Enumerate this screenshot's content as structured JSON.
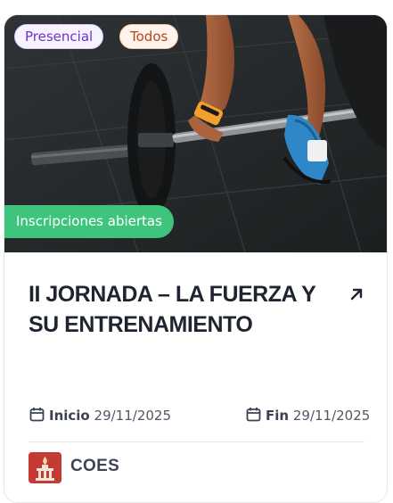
{
  "event_card": {
    "tags": {
      "modality": "Presencial",
      "audience": "Todos"
    },
    "status": "Inscripciones abiertas",
    "title": "II JORNADA – LA FUERZA Y SU ENTRENAMIENTO",
    "dates": {
      "start_label": "Inicio",
      "start_value": "29/11/2025",
      "end_label": "Fin",
      "end_value": "29/11/2025"
    },
    "organizer": {
      "name": "COES"
    },
    "icons": {
      "open": "arrow-up-right-icon",
      "calendar": "calendar-icon",
      "organizer_logo": "torch-logo-icon"
    },
    "colors": {
      "status_bg": "#3fc47e",
      "tag_presencial_text": "#6a35c9",
      "tag_todos_text": "#b5451b",
      "logo_bg": "#c43b33"
    }
  }
}
